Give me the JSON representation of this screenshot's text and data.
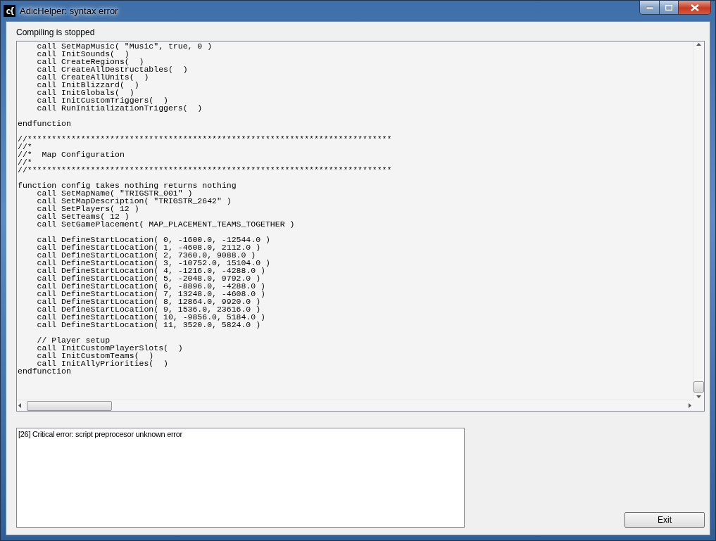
{
  "window": {
    "title": "AdicHelper: syntax error",
    "app_icon": "c{"
  },
  "status": "Compiling is stopped",
  "code_blocks": [
    [
      "    call SetMapMusic( \"Music\", true, 0 )",
      "    call InitSounds(  )",
      "    call CreateRegions(  )",
      "    call CreateAllDestructables(  )",
      "    call CreateAllUnits(  )",
      "    call InitBlizzard(  )",
      "    call InitGlobals(  )",
      "    call InitCustomTriggers(  )",
      "    call RunInitializationTriggers(  )"
    ],
    [
      "endfunction"
    ],
    [
      "//***************************************************************************",
      "//*",
      "//*  Map Configuration",
      "//*",
      "//***************************************************************************"
    ],
    [
      "function config takes nothing returns nothing",
      "    call SetMapName( \"TRIGSTR_001\" )",
      "    call SetMapDescription( \"TRIGSTR_2642\" )",
      "    call SetPlayers( 12 )",
      "    call SetTeams( 12 )",
      "    call SetGamePlacement( MAP_PLACEMENT_TEAMS_TOGETHER )"
    ],
    [
      "    call DefineStartLocation( 0, -1600.0, -12544.0 )",
      "    call DefineStartLocation( 1, -4608.0, 2112.0 )",
      "    call DefineStartLocation( 2, 7360.0, 9088.0 )",
      "    call DefineStartLocation( 3, -10752.0, 15104.0 )",
      "    call DefineStartLocation( 4, -1216.0, -4288.0 )",
      "    call DefineStartLocation( 5, -2048.0, 9792.0 )",
      "    call DefineStartLocation( 6, -8896.0, -4288.0 )",
      "    call DefineStartLocation( 7, 13248.0, -4608.0 )",
      "    call DefineStartLocation( 8, 12864.0, 9920.0 )",
      "    call DefineStartLocation( 9, 1536.0, 23616.0 )",
      "    call DefineStartLocation( 10, -9856.0, 5184.0 )",
      "    call DefineStartLocation( 11, 3520.0, 5824.0 )"
    ],
    [
      "    // Player setup",
      "    call InitCustomPlayerSlots(  )",
      "    call InitCustomTeams(  )",
      "    call InitAllyPriorities(  )",
      "endfunction"
    ]
  ],
  "errors": [
    "[26] Critical error: script preprocesor unknown error"
  ],
  "buttons": [
    "Exit"
  ]
}
